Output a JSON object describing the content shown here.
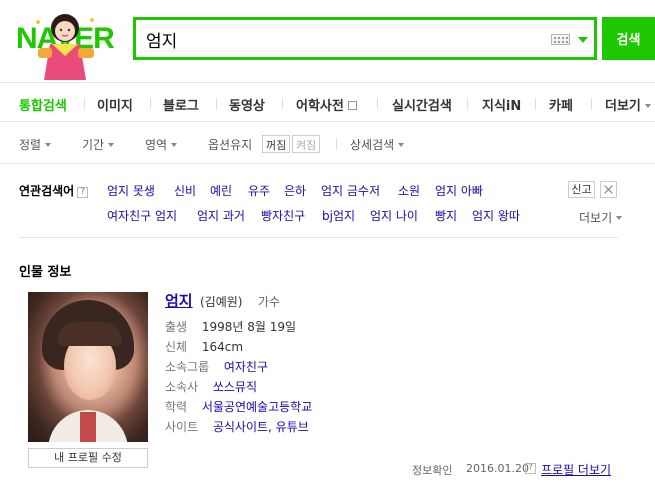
{
  "header": {
    "logo_text": "NAVER",
    "search_value": "엄지",
    "search_button": "검색"
  },
  "tabs": [
    {
      "label": "통합검색",
      "active": true
    },
    {
      "label": "이미지"
    },
    {
      "label": "블로그"
    },
    {
      "label": "동영상"
    },
    {
      "label": "어학사전"
    },
    {
      "label": "실시간검색"
    },
    {
      "label": "지식iN"
    },
    {
      "label": "카페"
    },
    {
      "label": "더보기"
    }
  ],
  "options": {
    "sort": "정렬",
    "period": "기간",
    "area": "영역",
    "keep_option": "옵션유지",
    "toggle_off": "꺼짐",
    "toggle_on": "켜짐",
    "detail_search": "상세검색"
  },
  "related": {
    "title": "연관검색어",
    "help": "?",
    "row1": [
      "엄지 못생",
      "신비",
      "예린",
      "유주",
      "은하",
      "엄지 금수저",
      "소원",
      "엄지 아빠"
    ],
    "row2": [
      "여자친구 엄지",
      "엄지 과거",
      "빵자친구",
      "bj엄지",
      "엄지 나이",
      "빵지",
      "엄지 왕따"
    ],
    "report": "신고",
    "more": "더보기"
  },
  "person": {
    "section_title": "인물 정보",
    "name": "엄지",
    "original_name": "(김예원)",
    "job": "가수",
    "rows": [
      {
        "label": "출생",
        "value": "1998년 8월 19일",
        "link": false
      },
      {
        "label": "신체",
        "value": "164cm",
        "link": false
      },
      {
        "label": "소속그룹",
        "value": "여자친구",
        "link": true
      },
      {
        "label": "소속사",
        "value": "쏘스뮤직",
        "link": true
      },
      {
        "label": "학력",
        "value": "서울공연예술고등학교",
        "link": true
      },
      {
        "label": "사이트",
        "value": "공식사이트, 유튜브",
        "link": true
      }
    ],
    "edit_profile": "내 프로필 수정",
    "verified_label": "정보확인",
    "verified_date": "2016.01.20",
    "verified_help": "?",
    "more_profile": "프로필 더보기"
  }
}
